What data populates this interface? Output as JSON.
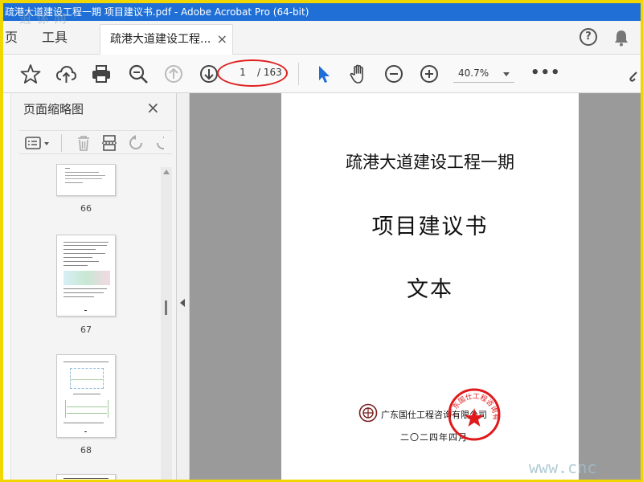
{
  "window": {
    "title": "疏港大道建设工程一期 项目建议书.pdf - Adobe Acrobat Pro (64-bit)"
  },
  "watermark": {
    "top": "逍 係 网",
    "bottom": "www.cnc"
  },
  "tabs": {
    "home": "页",
    "tools": "工具",
    "document": "疏港大道建设工程...",
    "close": "×",
    "help": "?"
  },
  "toolbar": {
    "page_current": "1",
    "page_total": "/ 163",
    "zoom": "40.7%",
    "more": "•••",
    "icons": [
      "star-icon",
      "cloud-upload-icon",
      "print-icon",
      "zoom-search-icon",
      "page-up-icon",
      "page-down-icon",
      "select-pointer-icon",
      "hand-icon",
      "zoom-out-icon",
      "zoom-in-icon",
      "link-icon"
    ],
    "highlight_color": "#e02020",
    "accent": "#1f6fd6"
  },
  "sidebar": {
    "title": "页面缩略图",
    "close": "×",
    "thumbnails": [
      {
        "label": "66"
      },
      {
        "label": "67"
      },
      {
        "label": "68"
      }
    ]
  },
  "document": {
    "title": "疏港大道建设工程一期",
    "subtitle": "项目建议书",
    "text": "文本",
    "company": "广东国仕工程咨询有限公司",
    "date": "二〇二四年四月",
    "seal_text": "广东国仕工程咨询有限公司"
  }
}
